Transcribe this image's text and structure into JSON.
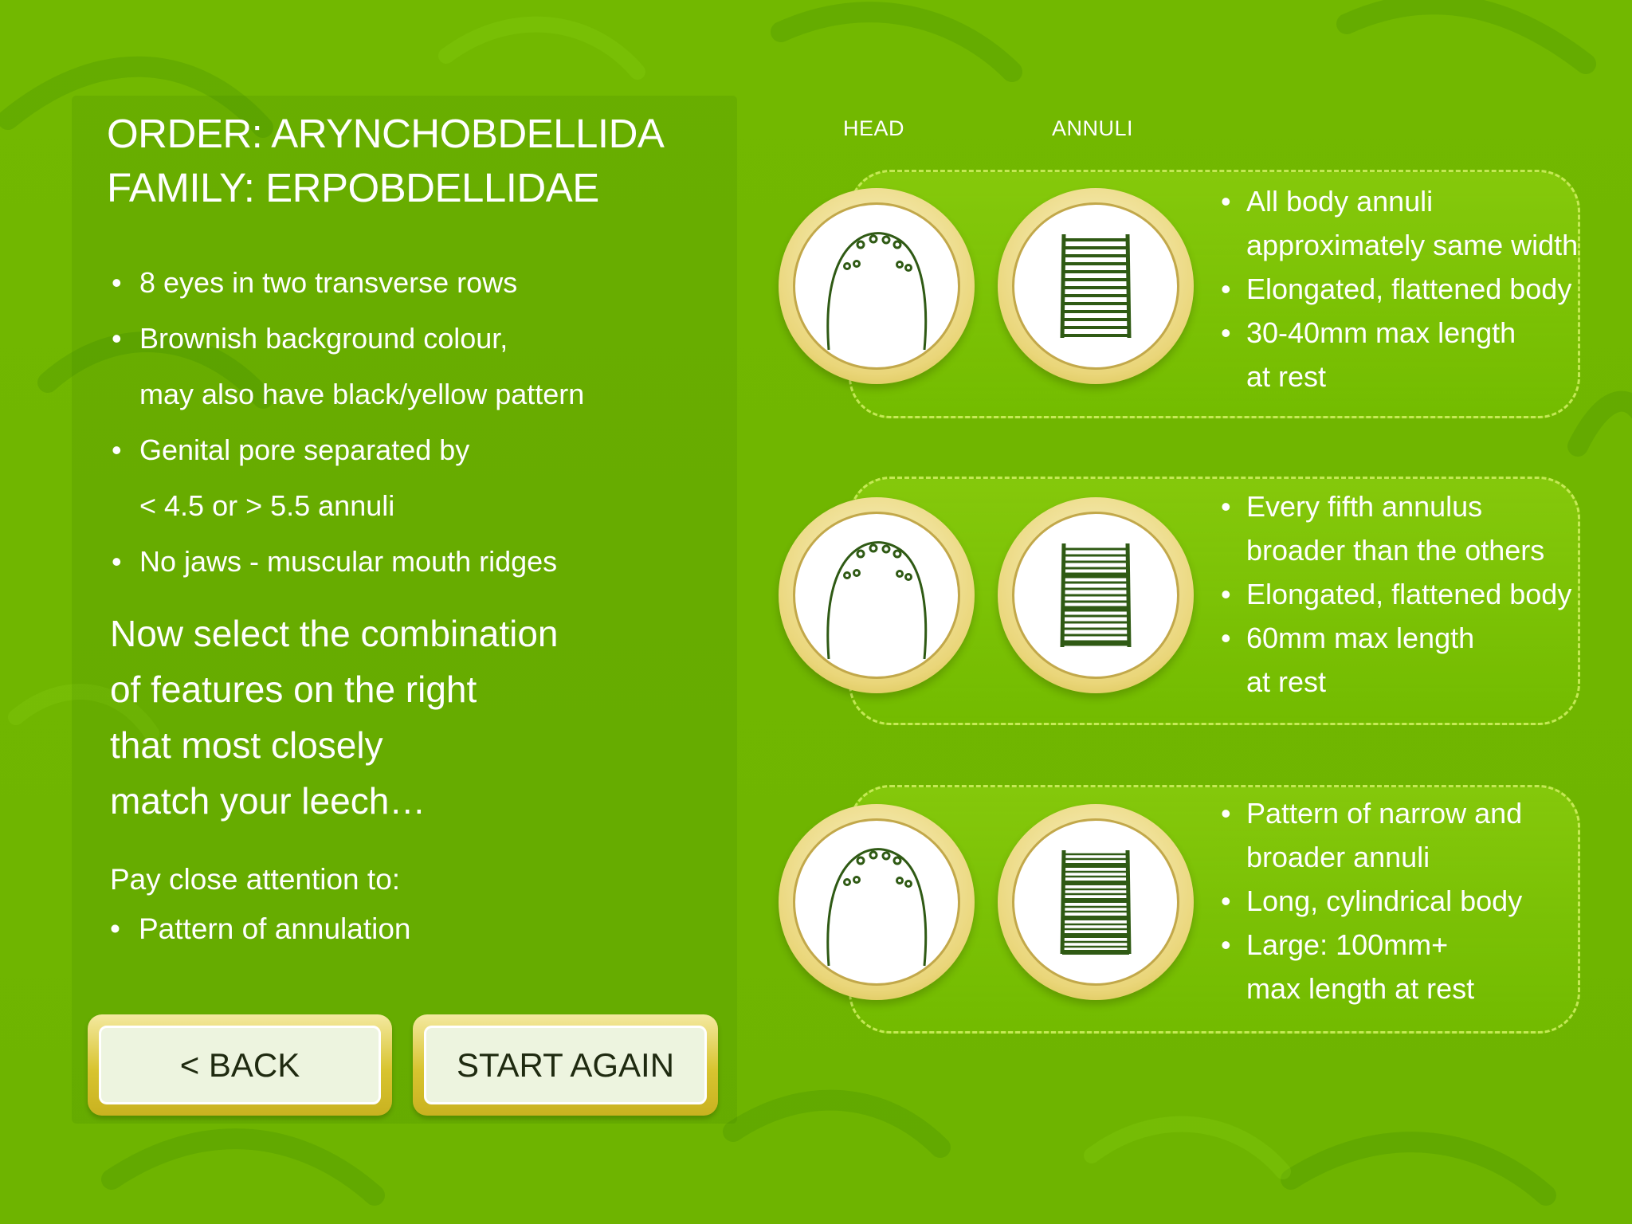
{
  "title": {
    "order": "ORDER: ARYNCHOBDELLIDA",
    "family": "FAMILY: ERPOBDELLIDAE"
  },
  "features": [
    "8 eyes in two transverse rows",
    "Brownish background colour,\nmay also have black/yellow pattern",
    "Genital pore separated by\n< 4.5 or > 5.5 annuli",
    "No jaws - muscular mouth ridges"
  ],
  "prompt": "Now select the combination\nof features on the right\nthat most closely\nmatch your leech…",
  "attention": {
    "label": "Pay close attention to:",
    "items": [
      "Pattern of annulation"
    ]
  },
  "buttons": {
    "back": "< BACK",
    "start_again": "START AGAIN"
  },
  "columns": {
    "head": "HEAD",
    "annuli": "ANNULI"
  },
  "options": [
    {
      "head_icon": "leech-head-eyes-icon",
      "annuli_icon": "uniform-annuli-icon",
      "lines": [
        "All body annuli\napproximately same width",
        "Elongated, flattened body",
        "30-40mm max length\nat rest"
      ]
    },
    {
      "head_icon": "leech-head-eyes-icon",
      "annuli_icon": "fifth-annulus-broad-icon",
      "lines": [
        "Every fifth annulus\nbroader than the others",
        "Elongated, flattened body",
        "60mm max length\nat rest"
      ]
    },
    {
      "head_icon": "leech-head-eyes-icon",
      "annuli_icon": "narrow-broad-annuli-icon",
      "lines": [
        "Pattern of narrow and\nbroader annuli",
        "Long, cylindrical body",
        "Large: 100mm+\nmax length at rest"
      ]
    }
  ],
  "colors": {
    "background": "#72b800",
    "button_frame": "#d8c430",
    "button_face": "#edf4df",
    "sketch": "#2f5a14"
  }
}
